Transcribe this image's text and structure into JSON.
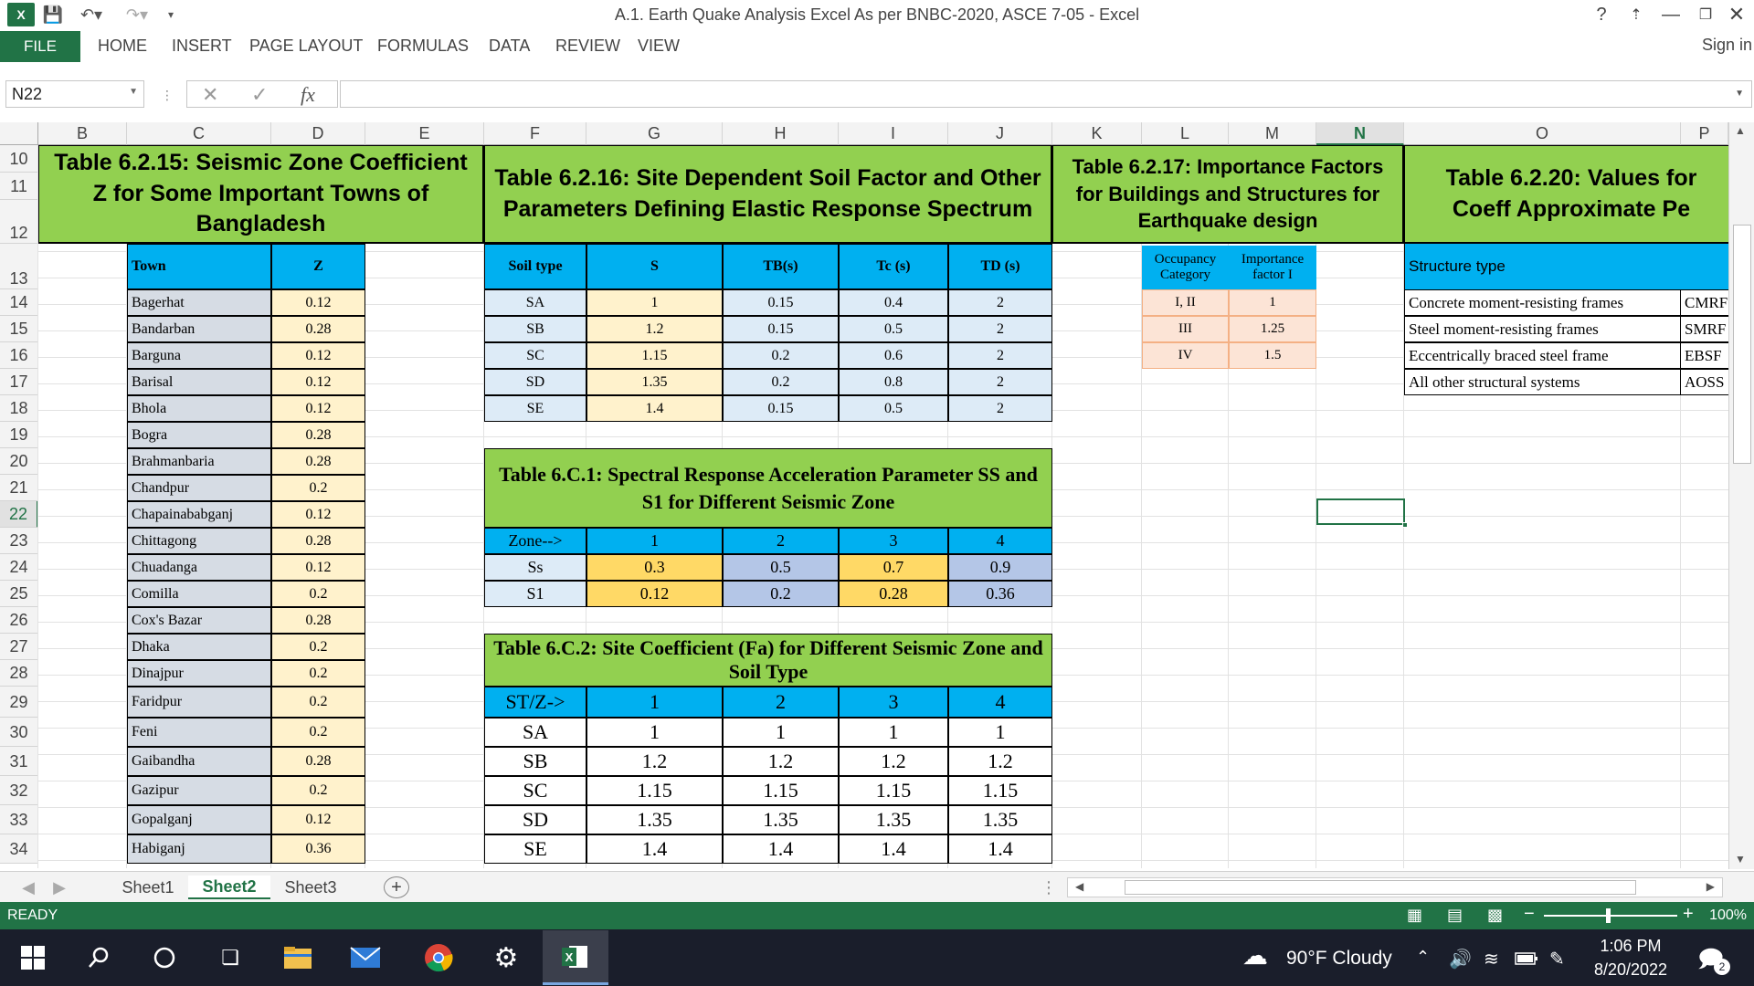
{
  "window": {
    "title": "A.1. Earth Quake Analysis Excel As per BNBC-2020, ASCE 7-05 - Excel",
    "help": "?",
    "sign_in": "Sign in"
  },
  "ribbon": {
    "file": "FILE",
    "tabs": [
      "HOME",
      "INSERT",
      "PAGE LAYOUT",
      "FORMULAS",
      "DATA",
      "REVIEW",
      "VIEW"
    ]
  },
  "formula_bar": {
    "name_box": "N22",
    "fx": "fx",
    "formula": ""
  },
  "columns": [
    "B",
    "C",
    "D",
    "E",
    "F",
    "G",
    "H",
    "I",
    "J",
    "K",
    "L",
    "M",
    "N",
    "O",
    "P"
  ],
  "selected_column": "N",
  "rows": [
    "10",
    "11",
    "12",
    "13",
    "14",
    "15",
    "16",
    "17",
    "18",
    "19",
    "20",
    "21",
    "22",
    "23",
    "24",
    "25",
    "26",
    "27",
    "28",
    "29",
    "30",
    "31",
    "32",
    "33",
    "34"
  ],
  "selected_row": "22",
  "table_6_2_15": {
    "title": "Table 6.2.15: Seismic Zone Coefficient Z for Some Important Towns of Bangladesh",
    "headers": [
      "Town",
      "Z"
    ],
    "rows": [
      [
        "Bagerhat",
        "0.12"
      ],
      [
        "Bandarban",
        "0.28"
      ],
      [
        "Barguna",
        "0.12"
      ],
      [
        "Barisal",
        "0.12"
      ],
      [
        "Bhola",
        "0.12"
      ],
      [
        "Bogra",
        "0.28"
      ],
      [
        "Brahmanbaria",
        "0.28"
      ],
      [
        "Chandpur",
        "0.2"
      ],
      [
        "Chapainababganj",
        "0.12"
      ],
      [
        "Chittagong",
        "0.28"
      ],
      [
        "Chuadanga",
        "0.12"
      ],
      [
        "Comilla",
        "0.2"
      ],
      [
        "Cox's Bazar",
        "0.28"
      ],
      [
        "Dhaka",
        "0.2"
      ],
      [
        "Dinajpur",
        "0.2"
      ],
      [
        "Faridpur",
        "0.2"
      ],
      [
        "Feni",
        "0.2"
      ],
      [
        "Gaibandha",
        "0.28"
      ],
      [
        "Gazipur",
        "0.2"
      ],
      [
        "Gopalganj",
        "0.12"
      ],
      [
        "Habiganj",
        "0.36"
      ]
    ]
  },
  "table_6_2_16": {
    "title": "Table 6.2.16: Site Dependent Soil Factor and Other Parameters Defining Elastic Response Spectrum",
    "headers": [
      "Soil type",
      "S",
      "TB(s)",
      "Tc (s)",
      "TD (s)"
    ],
    "rows": [
      [
        "SA",
        "1",
        "0.15",
        "0.4",
        "2"
      ],
      [
        "SB",
        "1.2",
        "0.15",
        "0.5",
        "2"
      ],
      [
        "SC",
        "1.15",
        "0.2",
        "0.6",
        "2"
      ],
      [
        "SD",
        "1.35",
        "0.2",
        "0.8",
        "2"
      ],
      [
        "SE",
        "1.4",
        "0.15",
        "0.5",
        "2"
      ]
    ]
  },
  "table_6_c_1": {
    "title": "Table 6.C.1: Spectral Response Acceleration Parameter SS and S1 for Different Seismic Zone",
    "headers": [
      "Zone-->",
      "1",
      "2",
      "3",
      "4"
    ],
    "rows": [
      [
        "Ss",
        "0.3",
        "0.5",
        "0.7",
        "0.9"
      ],
      [
        "S1",
        "0.12",
        "0.2",
        "0.28",
        "0.36"
      ]
    ]
  },
  "table_6_c_2": {
    "title": "Table 6.C.2: Site Coefficient  (Fa) for Different Seismic Zone and Soil Type",
    "headers": [
      "ST/Z->",
      "1",
      "2",
      "3",
      "4"
    ],
    "rows": [
      [
        "SA",
        "1",
        "1",
        "1",
        "1"
      ],
      [
        "SB",
        "1.2",
        "1.2",
        "1.2",
        "1.2"
      ],
      [
        "SC",
        "1.15",
        "1.15",
        "1.15",
        "1.15"
      ],
      [
        "SD",
        "1.35",
        "1.35",
        "1.35",
        "1.35"
      ],
      [
        "SE",
        "1.4",
        "1.4",
        "1.4",
        "1.4"
      ]
    ]
  },
  "table_6_2_17": {
    "title": "Table 6.2.17: Importance Factors for Buildings and Structures for Earthquake design",
    "headers": [
      "Occupancy Category",
      "Importance factor I"
    ],
    "rows": [
      [
        "I, II",
        "1"
      ],
      [
        "III",
        "1.25"
      ],
      [
        "IV",
        "1.5"
      ]
    ]
  },
  "table_6_2_20": {
    "title": "Table 6.2.20: Values for Coeff Approximate Pe",
    "header": "Structure type",
    "rows": [
      [
        "Concrete moment-resisting frames",
        "CMRF"
      ],
      [
        "Steel moment-resisting frames",
        "SMRF"
      ],
      [
        "Eccentrically braced steel frame",
        "EBSF"
      ],
      [
        "All other structural systems",
        "AOSS"
      ]
    ]
  },
  "sheet_tabs": [
    "Sheet1",
    "Sheet2",
    "Sheet3"
  ],
  "active_sheet": "Sheet2",
  "status": {
    "ready": "READY",
    "zoom": "100%"
  },
  "taskbar": {
    "weather": "90°F  Cloudy",
    "time": "1:06 PM",
    "date": "8/20/2022",
    "notifications": "2"
  }
}
